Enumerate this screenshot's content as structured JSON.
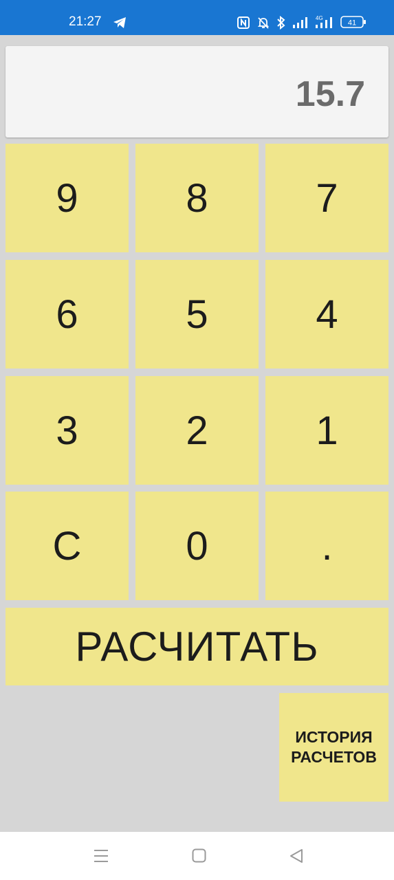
{
  "status_bar": {
    "time": "21:27",
    "battery": "41",
    "network": "4G",
    "icons": [
      "telegram-icon",
      "nfc-icon",
      "mute-icon",
      "bluetooth-icon",
      "signal-icon",
      "signal-4g-icon",
      "battery-icon"
    ]
  },
  "display": {
    "value": "15.7"
  },
  "keypad": {
    "row1": [
      "9",
      "8",
      "7"
    ],
    "row2": [
      "6",
      "5",
      "4"
    ],
    "row3": [
      "3",
      "2",
      "1"
    ],
    "row4": [
      "C",
      "0",
      "."
    ]
  },
  "calculate_button": {
    "label": "РАСЧИТАТЬ"
  },
  "history_button": {
    "line1": "ИСТОРИЯ",
    "line2": "РАСЧЕТОВ"
  },
  "nav_bar": {
    "icons": [
      "menu-icon",
      "home-icon",
      "back-icon"
    ]
  },
  "colors": {
    "status_bar": "#1976d2",
    "background": "#d6d6d6",
    "key": "#f0e68c",
    "display": "#f4f4f4",
    "display_text": "#6b6b6b"
  }
}
